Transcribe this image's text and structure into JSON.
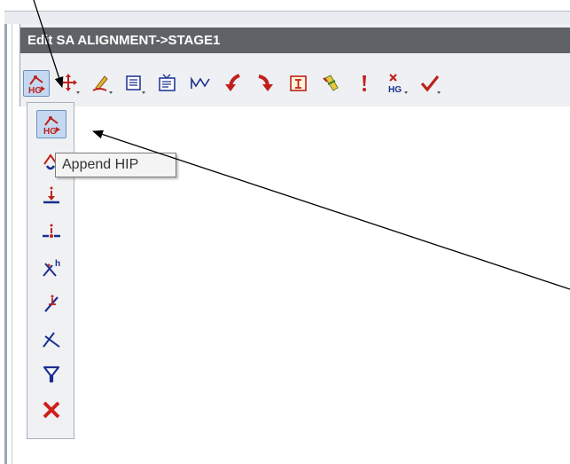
{
  "window": {
    "title": "Edit SA ALIGNMENT->STAGE1"
  },
  "toolbar": {
    "items": [
      {
        "icon": "hg-append-icon",
        "active": true
      },
      {
        "icon": "move-cross-icon"
      },
      {
        "icon": "pencil-edit-icon"
      },
      {
        "icon": "list-dropdown-icon"
      },
      {
        "icon": "display-icon"
      },
      {
        "icon": "curve-wave-icon"
      },
      {
        "icon": "arrow-left-curve-icon"
      },
      {
        "icon": "arrow-right-curve-icon"
      },
      {
        "icon": "text-box-icon"
      },
      {
        "icon": "eraser-icon"
      },
      {
        "icon": "exclamation-icon"
      },
      {
        "icon": "delete-hg-icon"
      },
      {
        "icon": "checkmark-icon"
      }
    ]
  },
  "flyout": {
    "items": [
      {
        "icon": "hg-append-icon",
        "active": true
      },
      {
        "icon": "insert-hip-icon"
      },
      {
        "icon": "point-down-icon"
      },
      {
        "icon": "point-split-icon"
      },
      {
        "icon": "cross-h-icon"
      },
      {
        "icon": "slash-point-icon"
      },
      {
        "icon": "cross-icon"
      },
      {
        "icon": "filter-icon"
      },
      {
        "icon": "red-x-icon"
      }
    ]
  },
  "tooltip": {
    "text": "Append HIP"
  },
  "colors": {
    "title_bar": "#5f6368",
    "toolbar_bg": "#eef0f3",
    "active_bg": "#c4d9f1",
    "icon_red": "#c0201c",
    "icon_blue": "#1a2f8f"
  }
}
